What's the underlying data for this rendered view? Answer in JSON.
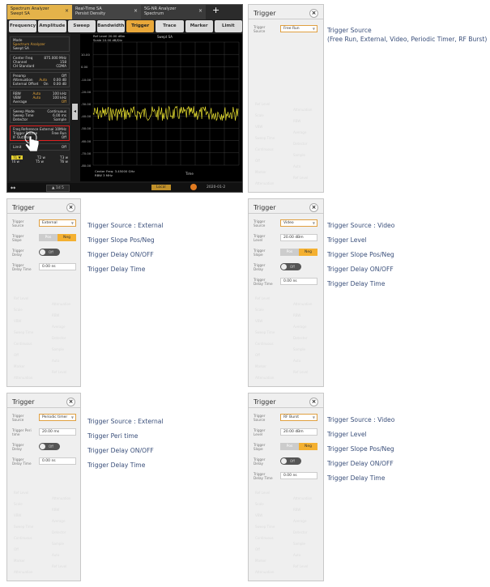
{
  "analyzer": {
    "tabs": [
      {
        "title": "Spectrum Analyzer",
        "sub": "Swept SA"
      },
      {
        "title": "Real-Time SA",
        "sub": "Persist Density"
      },
      {
        "title": "5G-NR Analyzer",
        "sub": "Spectrum"
      }
    ],
    "menus": [
      "Frequency",
      "Amplitude",
      "Sweep",
      "Bandwidth",
      "Trigger",
      "Trace",
      "Marker",
      "Limit"
    ],
    "active_menu": "Trigger",
    "left_panel": {
      "mode_label": "Mode",
      "mode_value": "Spectrum Analyzer",
      "mode_sub": "Swept SA",
      "center_freq_label": "Center Freq",
      "center_freq_value": "875.000 MHz",
      "channel_label": "Channel",
      "channel_value": "158",
      "ch_standard_label": "CH Standard",
      "ch_standard_value": "CDMA",
      "preamp_label": "Preamp",
      "preamp_value": "Off",
      "atten_label": "Attenuation",
      "atten_mode": "Auto",
      "atten_value": "0.00 dB",
      "ext_offset_label": "External Offset",
      "ext_offset_mode": "On",
      "ext_offset_value": "0.00 dB",
      "rbw_label": "RBW",
      "rbw_mode": "Auto",
      "rbw_value": "100 kHz",
      "vbw_label": "VBW",
      "vbw_mode": "Auto",
      "vbw_value": "100 kHz",
      "average_label": "Average",
      "average_mode": "Off",
      "sweep_mode_label": "Sweep Mode",
      "sweep_mode_value": "Continuous",
      "sweep_time_label": "Sweep Time",
      "sweep_time_value": "6.00 ms",
      "detector_label": "Detector",
      "detector_value": "Sample",
      "freq_ref_label": "Freq Reference",
      "freq_ref_value": "External 10MHz",
      "trigger_source_label": "Trigger Source",
      "trigger_source_value": "Free Run",
      "ext_out_label": "IF Out/Pol",
      "ext_out_value": "Off",
      "limit_label": "Limit",
      "limit_value": "Off",
      "bottom_row1": [
        "T1 ▼",
        "T2 w",
        "T3 w"
      ],
      "bottom_row2": [
        "T4 w",
        "T5 w",
        "T6 w"
      ]
    },
    "plot": {
      "ref_level": "Ref Level 20.00 dBm",
      "scale": "Scale 10.00 dB/Div",
      "mode": "Swept SA",
      "y_ticks": [
        "10.00",
        "0.00",
        "-10.00",
        "-20.00",
        "-30.00",
        "-40.00",
        "-50.00",
        "-60.00",
        "-70.00",
        "-80.00"
      ],
      "center_freq": "Center Freq: 3.45000 GHz",
      "rbw": "RBW 3 MHz",
      "time_label": "Time"
    },
    "status": {
      "left": "▲ 1d 5",
      "mid": "Local",
      "right": "2020-01-2"
    }
  },
  "panels": [
    {
      "title": "Trigger",
      "source_label": "Trigger Source",
      "source_value": "Free Run",
      "annotations": [
        "Trigger Source",
        "(Free Run, External, Video, Periodic Timer, RF Burst)"
      ]
    },
    {
      "title": "Trigger",
      "source_label": "Trigger Source",
      "source_value": "External",
      "slope_label": "Trigger Slope",
      "slope_pos": "Pos",
      "slope_neg": "Neg",
      "delay_label": "Trigger Delay",
      "delay_toggle": "Off",
      "delay_time_label": "Trigger Delay Time",
      "delay_time_value": "0.00 ns",
      "annotations": [
        "Trigger Source : External",
        "Trigger Slope Pos/Neg",
        "Trigger Delay ON/OFF",
        "Trigger Delay Time"
      ]
    },
    {
      "title": "Trigger",
      "source_label": "Trigger Source",
      "source_value": "Video",
      "level_label": "Trigger Level",
      "level_value": "20.00 dBm",
      "slope_label": "Trigger Slope",
      "slope_pos": "Pos",
      "slope_neg": "Neg",
      "delay_label": "Trigger Delay",
      "delay_toggle": "Off",
      "delay_time_label": "Trigger Delay Time",
      "delay_time_value": "0.00 ns",
      "annotations": [
        "Trigger Source : Video",
        "Trigger Level",
        "Trigger Slope Pos/Neg",
        "Trigger Delay ON/OFF",
        "Trigger Delay Time"
      ]
    },
    {
      "title": "Trigger",
      "source_label": "Trigger Source",
      "source_value": "Periodic timer",
      "period_label": "Trigger Peri time",
      "period_value": "20.00 ms",
      "delay_label": "Trigger Delay",
      "delay_toggle": "Off",
      "delay_time_label": "Trigger Delay Time",
      "delay_time_value": "0.00 ns",
      "annotations": [
        "Trigger Source : External",
        "Trigger Peri time",
        "Trigger Delay ON/OFF",
        "Trigger Delay Time"
      ]
    },
    {
      "title": "Trigger",
      "source_label": "Trigger Source",
      "source_value": "RF Burst",
      "level_label": "Trigger Level",
      "level_value": "20.00 dBm",
      "slope_label": "Trigger Slope",
      "slope_pos": "Pos",
      "slope_neg": "Neg",
      "delay_label": "Trigger Delay",
      "delay_toggle": "Off",
      "delay_time_label": "Trigger Delay Time",
      "delay_time_value": "0.00 ns",
      "annotations": [
        "Trigger Source : Video",
        "Trigger Level",
        "Trigger Slope Pos/Neg",
        "Trigger Delay ON/OFF",
        "Trigger Delay Time"
      ]
    }
  ],
  "colors": {
    "accent": "#f4b030",
    "trace": "#e8e030",
    "highlight": "#e02020",
    "annotation": "#3a4f7a"
  }
}
